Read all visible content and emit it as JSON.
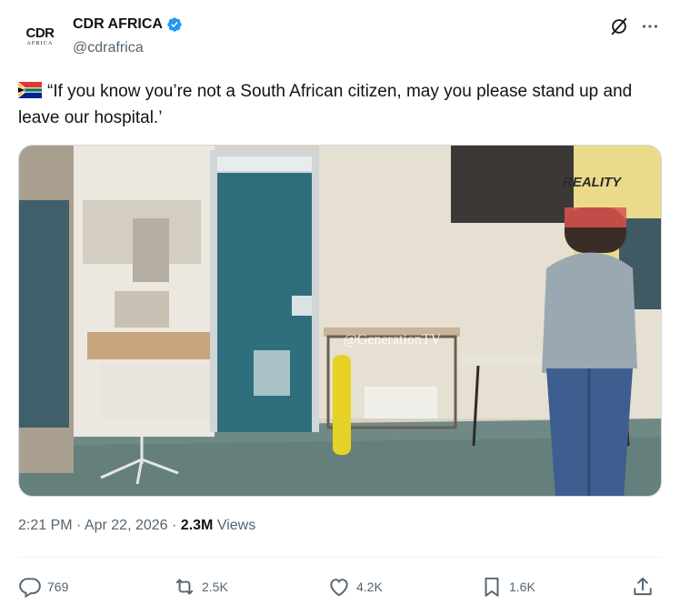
{
  "author": {
    "avatar_logo_text": "CDR",
    "avatar_logo_sub": "AFRICA",
    "display_name": "CDR AFRICA",
    "handle": "@cdrafrica",
    "verified": true
  },
  "header_icons": [
    "grok-icon",
    "more-icon"
  ],
  "tweet": {
    "flag_icon": "south-africa-flag-icon",
    "text": "“If you know you’re not a South African citizen, may you please stand up and leave our hospital.’"
  },
  "media": {
    "watermark": "@GenerationTV",
    "overlay_badge": "REALITY"
  },
  "meta": {
    "time": "2:21 PM",
    "separator": "·",
    "date": "Apr 22, 2026",
    "views_count": "2.3M",
    "views_label": "Views"
  },
  "actions": {
    "replies": "769",
    "reposts": "2.5K",
    "likes": "4.2K",
    "bookmarks": "1.6K"
  },
  "colors": {
    "text_primary": "#0f1419",
    "text_secondary": "#536471",
    "verified_blue": "#1d9bf0",
    "divider": "#eff3f4"
  }
}
